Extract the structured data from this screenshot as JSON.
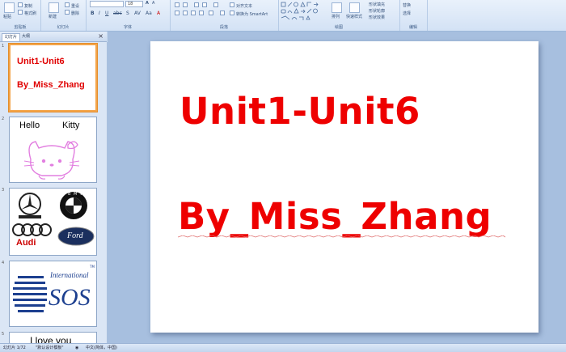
{
  "ribbon": {
    "clipboard": {
      "paste": "粘贴",
      "copy": "复制",
      "format_painter": "格式刷",
      "label": "剪贴板"
    },
    "slides": {
      "new_slide": "新建",
      "reset": "重设",
      "delete": "删除",
      "label": "幻灯片"
    },
    "font": {
      "size": "18",
      "label": "字体"
    },
    "paragraph": {
      "align_text": "对齐文本",
      "convert_smartart": "转换为 SmartArt",
      "label": "段落"
    },
    "drawing": {
      "arrange": "排列",
      "quick_styles": "快速样式",
      "shape_fill": "形状填充",
      "shape_outline": "形状轮廓",
      "shape_effects": "形状效果",
      "label": "绘图"
    },
    "editing": {
      "find": "替换",
      "select": "选择",
      "label": "编辑"
    }
  },
  "panel": {
    "tabs": [
      "幻灯片",
      "大纲"
    ],
    "close": "×",
    "slides": [
      {
        "number": "1",
        "line1": "Unit1-Unit6",
        "line2": "By_Miss_Zhang"
      },
      {
        "number": "2",
        "caption_left": "Hello",
        "caption_right": "Kitty"
      },
      {
        "number": "3",
        "logo_bmw": "B M W",
        "logo_audi": "Audi",
        "logo_ford": "Ford"
      },
      {
        "number": "4",
        "brand_top": "International",
        "brand_main": "SOS",
        "trademark": "TM"
      },
      {
        "number": "5",
        "text": "I love you"
      }
    ]
  },
  "slide": {
    "title": "Unit1-Unit6",
    "subtitle": "By_Miss_Zhang",
    "text_color": "#ee0000"
  },
  "status": {
    "slide_count": "幻灯片 1/72",
    "theme": "\"默认设计模板\"",
    "language": "中文(简体，中国)"
  }
}
